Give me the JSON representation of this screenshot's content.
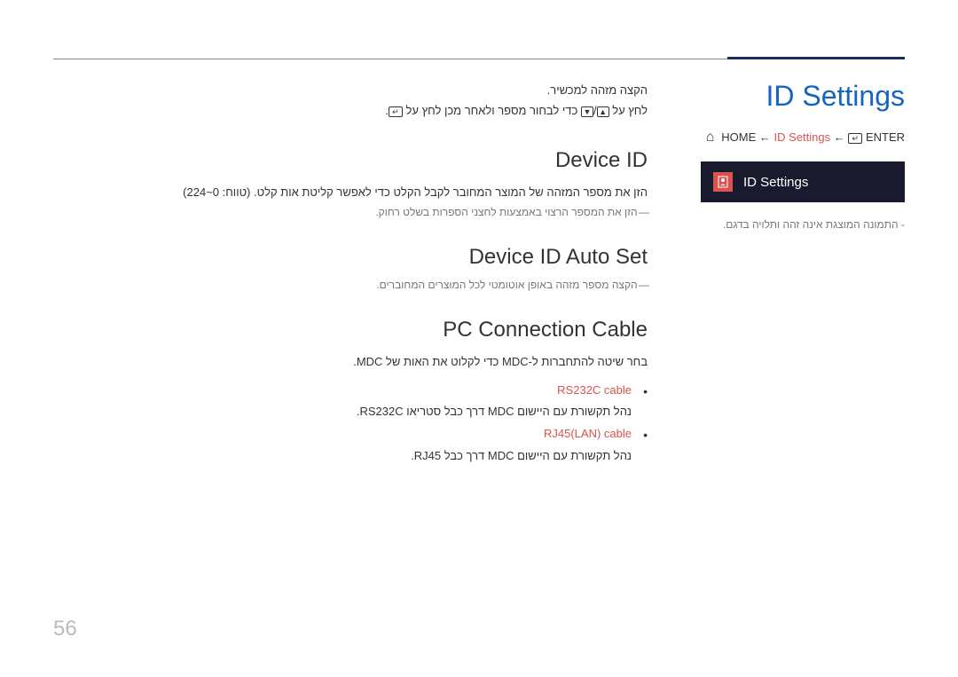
{
  "page_number": "56",
  "main_title": "ID Settings",
  "breadcrumb": {
    "home": "HOME",
    "mid": "ID Settings",
    "enter": "ENTER"
  },
  "menu": {
    "label": "ID Settings"
  },
  "note": "התמונה המוצגת אינה זהה ותלויה בדגם.",
  "intro": {
    "line1": "הקצה מזהה למכשיר.",
    "line2_a": "לחץ על ",
    "line2_b": " כדי לבחור מספר ולאחר מכן לחץ על "
  },
  "sections": {
    "device_id": {
      "title": "Device ID",
      "text": "הזן את מספר המזהה של המוצר המחובר לקבל הקלט כדי לאפשר קליטת אות קלט. (טווח: 0~224)",
      "subnote": "הזן את המספר הרצוי באמצעות לחצני הספרות בשלט רחוק."
    },
    "auto_set": {
      "title": "Device ID Auto Set",
      "subnote": "הקצה מספר מזהה באופן אוטומטי לכל המוצרים המחוברים."
    },
    "pc_cable": {
      "title": "PC Connection Cable",
      "text": "בחר שיטה להתחברות ל-MDC כדי לקלוט את האות של MDC.",
      "items": [
        {
          "label": "RS232C cable",
          "desc": "נהל תקשורת עם היישום MDC דרך כבל סטריאו RS232C."
        },
        {
          "label": "RJ45(LAN) cable",
          "desc": "נהל תקשורת עם היישום MDC דרך כבל RJ45."
        }
      ]
    }
  }
}
